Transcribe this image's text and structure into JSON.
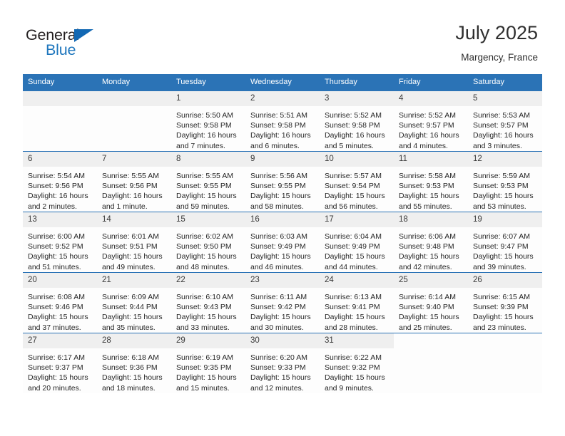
{
  "logo": {
    "word1": "General",
    "word2": "Blue",
    "triangle_color": "#1268b3",
    "blue_color": "#1e76bd"
  },
  "header": {
    "title": "July 2025",
    "subtitle": "Margency, France"
  },
  "theme": {
    "header_bg": "#2b73b6",
    "header_text": "#ffffff",
    "daynum_bg": "#efefef",
    "cell_bg": "#fdfdfd",
    "rule_color": "#2b73b6"
  },
  "weekday_headers": [
    "Sunday",
    "Monday",
    "Tuesday",
    "Wednesday",
    "Thursday",
    "Friday",
    "Saturday"
  ],
  "weeks": [
    [
      {
        "day": "",
        "lines": []
      },
      {
        "day": "",
        "lines": []
      },
      {
        "day": "1",
        "lines": [
          "Sunrise: 5:50 AM",
          "Sunset: 9:58 PM",
          "Daylight: 16 hours",
          "and 7 minutes."
        ]
      },
      {
        "day": "2",
        "lines": [
          "Sunrise: 5:51 AM",
          "Sunset: 9:58 PM",
          "Daylight: 16 hours",
          "and 6 minutes."
        ]
      },
      {
        "day": "3",
        "lines": [
          "Sunrise: 5:52 AM",
          "Sunset: 9:58 PM",
          "Daylight: 16 hours",
          "and 5 minutes."
        ]
      },
      {
        "day": "4",
        "lines": [
          "Sunrise: 5:52 AM",
          "Sunset: 9:57 PM",
          "Daylight: 16 hours",
          "and 4 minutes."
        ]
      },
      {
        "day": "5",
        "lines": [
          "Sunrise: 5:53 AM",
          "Sunset: 9:57 PM",
          "Daylight: 16 hours",
          "and 3 minutes."
        ]
      }
    ],
    [
      {
        "day": "6",
        "lines": [
          "Sunrise: 5:54 AM",
          "Sunset: 9:56 PM",
          "Daylight: 16 hours",
          "and 2 minutes."
        ]
      },
      {
        "day": "7",
        "lines": [
          "Sunrise: 5:55 AM",
          "Sunset: 9:56 PM",
          "Daylight: 16 hours",
          "and 1 minute."
        ]
      },
      {
        "day": "8",
        "lines": [
          "Sunrise: 5:55 AM",
          "Sunset: 9:55 PM",
          "Daylight: 15 hours",
          "and 59 minutes."
        ]
      },
      {
        "day": "9",
        "lines": [
          "Sunrise: 5:56 AM",
          "Sunset: 9:55 PM",
          "Daylight: 15 hours",
          "and 58 minutes."
        ]
      },
      {
        "day": "10",
        "lines": [
          "Sunrise: 5:57 AM",
          "Sunset: 9:54 PM",
          "Daylight: 15 hours",
          "and 56 minutes."
        ]
      },
      {
        "day": "11",
        "lines": [
          "Sunrise: 5:58 AM",
          "Sunset: 9:53 PM",
          "Daylight: 15 hours",
          "and 55 minutes."
        ]
      },
      {
        "day": "12",
        "lines": [
          "Sunrise: 5:59 AM",
          "Sunset: 9:53 PM",
          "Daylight: 15 hours",
          "and 53 minutes."
        ]
      }
    ],
    [
      {
        "day": "13",
        "lines": [
          "Sunrise: 6:00 AM",
          "Sunset: 9:52 PM",
          "Daylight: 15 hours",
          "and 51 minutes."
        ]
      },
      {
        "day": "14",
        "lines": [
          "Sunrise: 6:01 AM",
          "Sunset: 9:51 PM",
          "Daylight: 15 hours",
          "and 49 minutes."
        ]
      },
      {
        "day": "15",
        "lines": [
          "Sunrise: 6:02 AM",
          "Sunset: 9:50 PM",
          "Daylight: 15 hours",
          "and 48 minutes."
        ]
      },
      {
        "day": "16",
        "lines": [
          "Sunrise: 6:03 AM",
          "Sunset: 9:49 PM",
          "Daylight: 15 hours",
          "and 46 minutes."
        ]
      },
      {
        "day": "17",
        "lines": [
          "Sunrise: 6:04 AM",
          "Sunset: 9:49 PM",
          "Daylight: 15 hours",
          "and 44 minutes."
        ]
      },
      {
        "day": "18",
        "lines": [
          "Sunrise: 6:06 AM",
          "Sunset: 9:48 PM",
          "Daylight: 15 hours",
          "and 42 minutes."
        ]
      },
      {
        "day": "19",
        "lines": [
          "Sunrise: 6:07 AM",
          "Sunset: 9:47 PM",
          "Daylight: 15 hours",
          "and 39 minutes."
        ]
      }
    ],
    [
      {
        "day": "20",
        "lines": [
          "Sunrise: 6:08 AM",
          "Sunset: 9:46 PM",
          "Daylight: 15 hours",
          "and 37 minutes."
        ]
      },
      {
        "day": "21",
        "lines": [
          "Sunrise: 6:09 AM",
          "Sunset: 9:44 PM",
          "Daylight: 15 hours",
          "and 35 minutes."
        ]
      },
      {
        "day": "22",
        "lines": [
          "Sunrise: 6:10 AM",
          "Sunset: 9:43 PM",
          "Daylight: 15 hours",
          "and 33 minutes."
        ]
      },
      {
        "day": "23",
        "lines": [
          "Sunrise: 6:11 AM",
          "Sunset: 9:42 PM",
          "Daylight: 15 hours",
          "and 30 minutes."
        ]
      },
      {
        "day": "24",
        "lines": [
          "Sunrise: 6:13 AM",
          "Sunset: 9:41 PM",
          "Daylight: 15 hours",
          "and 28 minutes."
        ]
      },
      {
        "day": "25",
        "lines": [
          "Sunrise: 6:14 AM",
          "Sunset: 9:40 PM",
          "Daylight: 15 hours",
          "and 25 minutes."
        ]
      },
      {
        "day": "26",
        "lines": [
          "Sunrise: 6:15 AM",
          "Sunset: 9:39 PM",
          "Daylight: 15 hours",
          "and 23 minutes."
        ]
      }
    ],
    [
      {
        "day": "27",
        "lines": [
          "Sunrise: 6:17 AM",
          "Sunset: 9:37 PM",
          "Daylight: 15 hours",
          "and 20 minutes."
        ]
      },
      {
        "day": "28",
        "lines": [
          "Sunrise: 6:18 AM",
          "Sunset: 9:36 PM",
          "Daylight: 15 hours",
          "and 18 minutes."
        ]
      },
      {
        "day": "29",
        "lines": [
          "Sunrise: 6:19 AM",
          "Sunset: 9:35 PM",
          "Daylight: 15 hours",
          "and 15 minutes."
        ]
      },
      {
        "day": "30",
        "lines": [
          "Sunrise: 6:20 AM",
          "Sunset: 9:33 PM",
          "Daylight: 15 hours",
          "and 12 minutes."
        ]
      },
      {
        "day": "31",
        "lines": [
          "Sunrise: 6:22 AM",
          "Sunset: 9:32 PM",
          "Daylight: 15 hours",
          "and 9 minutes."
        ]
      },
      {
        "day": "",
        "lines": []
      },
      {
        "day": "",
        "lines": []
      }
    ]
  ]
}
